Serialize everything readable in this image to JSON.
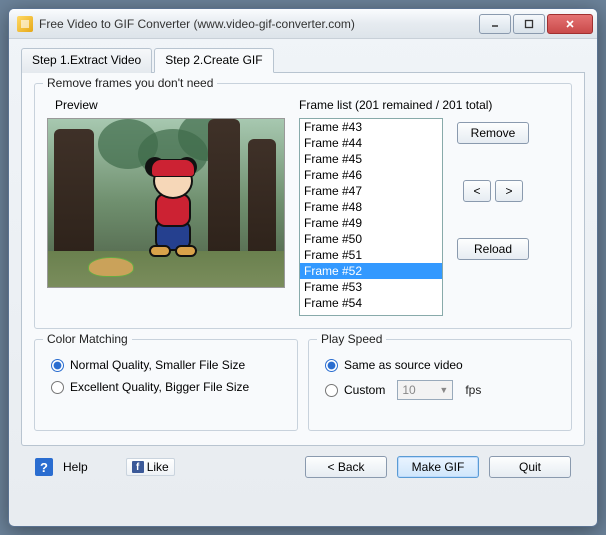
{
  "window": {
    "title": "Free Video to GIF Converter (www.video-gif-converter.com)"
  },
  "tabs": {
    "step1": "Step 1.Extract Video",
    "step2": "Step 2.Create GIF"
  },
  "removeFrames": {
    "legend": "Remove frames you don't need",
    "previewLabel": "Preview",
    "frameListLabel": "Frame list (201 remained / 201 total)",
    "frames": [
      "Frame #43",
      "Frame #44",
      "Frame #45",
      "Frame #46",
      "Frame #47",
      "Frame #48",
      "Frame #49",
      "Frame #50",
      "Frame #51",
      "Frame #52",
      "Frame #53",
      "Frame #54"
    ],
    "selectedIndex": 9,
    "removeBtn": "Remove",
    "prevBtn": "<",
    "nextBtn": ">",
    "reloadBtn": "Reload"
  },
  "colorMatching": {
    "legend": "Color Matching",
    "normal": "Normal Quality, Smaller File Size",
    "excellent": "Excellent Quality, Bigger File Size",
    "selected": "normal"
  },
  "playSpeed": {
    "legend": "Play Speed",
    "same": "Same as source video",
    "custom": "Custom",
    "fpsValue": "10",
    "fpsUnit": "fps",
    "selected": "same"
  },
  "bottom": {
    "help": "Help",
    "like": "Like",
    "back": "< Back",
    "make": "Make GIF",
    "quit": "Quit"
  }
}
